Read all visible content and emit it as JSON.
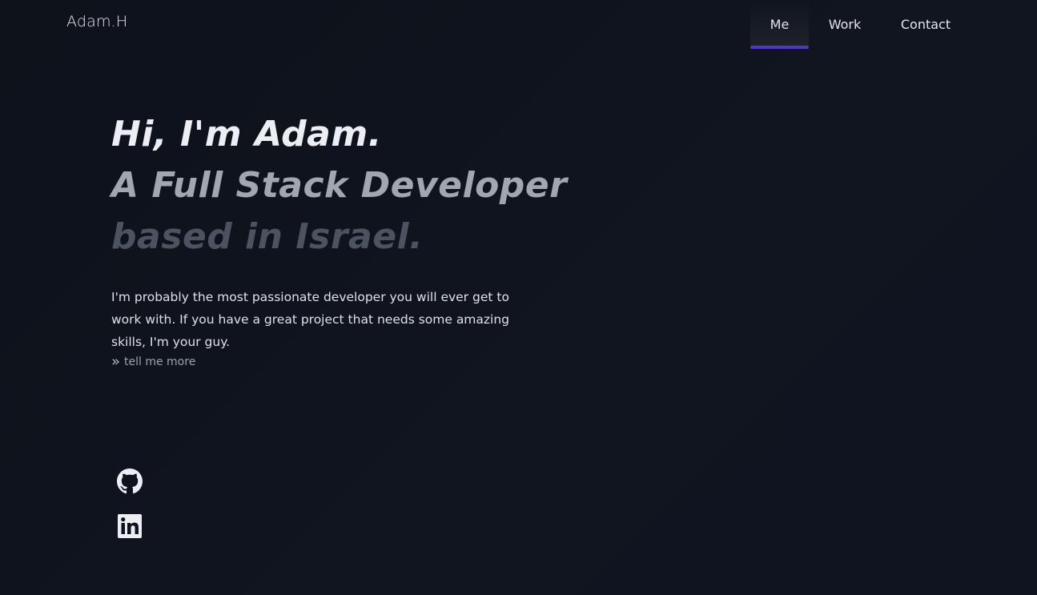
{
  "header": {
    "logo": "Adam.H",
    "nav": [
      {
        "label": "Me",
        "active": true
      },
      {
        "label": "Work",
        "active": false
      },
      {
        "label": "Contact",
        "active": false
      }
    ],
    "accent_color": "#4f36c9"
  },
  "hero": {
    "line1": "Hi, I'm Adam.",
    "line2": "A Full Stack Developer",
    "line3": "based in Israel."
  },
  "intro": {
    "text": "I'm probably the most passionate developer you will ever get to work with. If you have a great project that needs some amazing skills, I'm your guy.",
    "more_icon": "»",
    "more_label": "tell me more"
  },
  "social": [
    {
      "icon": "github-icon"
    },
    {
      "icon": "linkedin-icon"
    }
  ]
}
